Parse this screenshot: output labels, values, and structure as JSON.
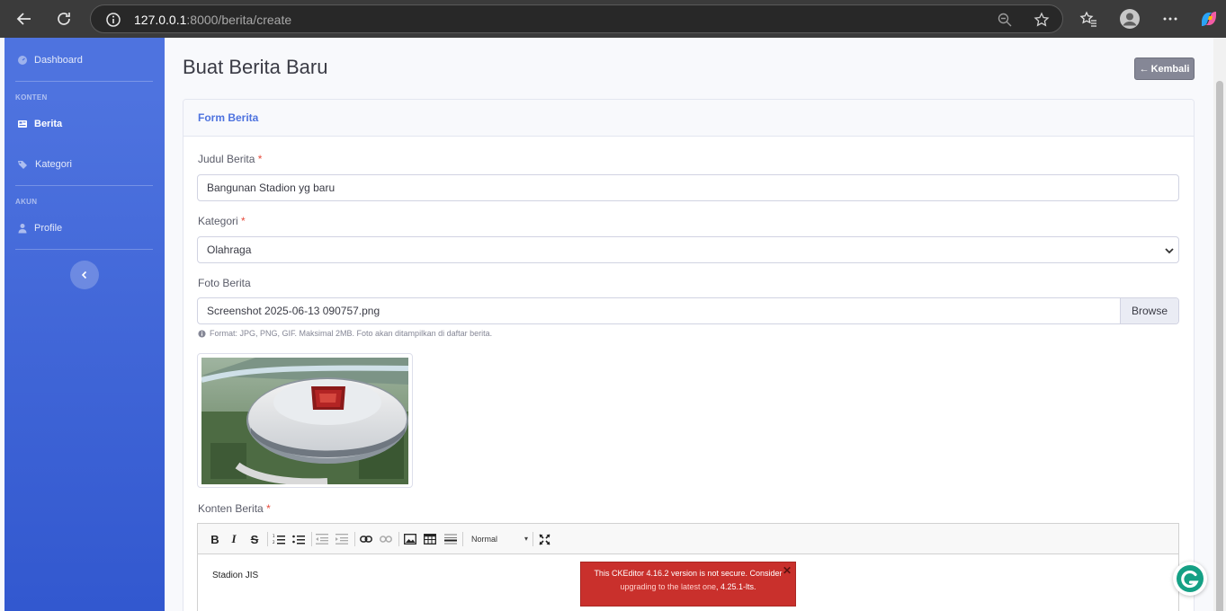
{
  "browser": {
    "url_host": "127.0.0.1",
    "url_path": ":8000/berita/create"
  },
  "sidebar": {
    "dashboard_label": "Dashboard",
    "heading_konten": "KONTEN",
    "berita_label": "Berita",
    "kategori_label": "Kategori",
    "heading_akun": "AKUN",
    "profile_label": "Profile"
  },
  "header": {
    "title": "Buat Berita Baru",
    "back_label": "Kembali"
  },
  "form": {
    "card_title": "Form Berita",
    "judul": {
      "label": "Judul Berita",
      "required_mark": "*",
      "value": "Bangunan Stadion yg baru"
    },
    "kategori": {
      "label": "Kategori",
      "required_mark": "*",
      "selected": "Olahraga"
    },
    "foto": {
      "label": "Foto Berita",
      "file_name": "Screenshot 2025-06-13 090757.png",
      "browse_label": "Browse",
      "help": "Format: JPG, PNG, GIF. Maksimal 2MB. Foto akan ditampilkan di daftar berita."
    },
    "konten": {
      "label": "Konten Berita",
      "required_mark": "*",
      "format_value": "Normal",
      "content": "Stadion JIS"
    }
  },
  "editor_warning": {
    "text_before": "This CKEditor 4.16.2 version is not secure. Consider",
    "link_text": "upgrading to the latest one",
    "text_after": ", 4.25.1-lts.",
    "close": "✕"
  },
  "colors": {
    "primary": "#4e73df",
    "sidebar_end": "#3258cf",
    "danger": "#e74a3b",
    "warning_bg": "#c9302c",
    "secondary_btn": "#858796"
  },
  "icons": [
    "back-arrow-icon",
    "refresh-icon",
    "info-icon",
    "zoom-icon",
    "star-icon",
    "favorites-icon",
    "profile-icon",
    "more-icon",
    "copilot-icon",
    "dashboard-icon",
    "newspaper-icon",
    "tags-icon",
    "user-icon",
    "chevron-left-icon",
    "grammarly-icon"
  ]
}
